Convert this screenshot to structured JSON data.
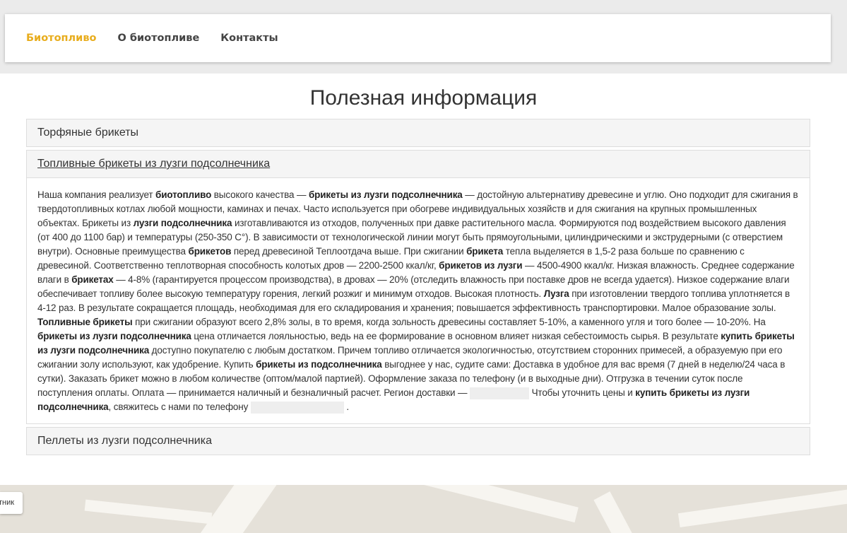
{
  "nav": {
    "items": [
      {
        "label": "Биотопливо",
        "active": true
      },
      {
        "label": "О биотопливе",
        "active": false
      },
      {
        "label": "Контакты",
        "active": false
      }
    ]
  },
  "page": {
    "title": "Полезная информация"
  },
  "accordion": {
    "panel1_title": "Торфяные брикеты",
    "panel2_title": "Топливные брикеты из лузги подсолнечника",
    "panel3_title": "Пеллеты из лузги подсолнечника",
    "body": {
      "t01": "Наша компания реализует ",
      "b01": "биотопливо",
      "t02": " высокого качества — ",
      "b02": "брикеты из лузги подсолнечника",
      "t03": " — достойную альтернативу древесине и углю. Оно подходит для сжигания в твердотопливных котлах любой мощности, каминах и печах. Часто используется при обогреве индивидуальных хозяйств и для сжигания на крупных промышленных объектах. Брикеты из ",
      "b03": "лузги подсолнечника",
      "t04": " изготавливаются из отходов, полученных при давке растительного масла. Формируются под воздействием высокого давления (от 400 до 1100 бар) и температуры (250-350 С°). В зависимости от технологической линии могут быть прямоугольными, цилиндрическими и экструдерными (с отверстием внутри). Основные преимущества ",
      "b04": "брикетов",
      "t05": " перед древесиной Теплоотдача выше. При сжигании ",
      "b05": "брикета",
      "t06": " тепла выделяется в 1,5-2 раза больше по сравнению с древесиной. Соответственно теплотворная способность колотых дров — 2200-2500 ккал/кг, ",
      "b06": "брикетов из лузги",
      "t07": " — 4500-4900 ккал/кг. Низкая влажность. Среднее содержание влаги в ",
      "b07": "брикетах",
      "t08": " — 4-8% (гарантируется процессом производства), в дровах — 20% (отследить влажность при поставке дров не всегда удается). Низкое содержание влаги обеспечивает топливу более высокую температуру горения, легкий розжиг и минимум отходов. Высокая плотность. ",
      "b08": "Лузга",
      "t09": " при изготовлении твердого топлива уплотняется в 4-12 раз. В результате сокращается площадь, необходимая для его складирования и хранения; повышается эффективность транспортировки. Малое образование золы. ",
      "b09": "Топливные брикеты",
      "t10": " при сжигании образуют всего 2,8% золы, в то время, когда зольность древесины составляет 5-10%, а каменного угля и того более — 10-20%. На ",
      "b10": "брикеты из лузги подсолнечника",
      "t11": " цена отличается лояльностью, ведь на ее формирование в основном влияет низкая себестоимость сырья. В результате ",
      "b11": "купить брикеты из лузги подсолнечника",
      "t12": " доступно покупателю с любым достатком. Причем топливо отличается экологичностью, отсутствием сторонних примесей, а образуемую при его сжигании золу используют, как удобрение. Купить ",
      "b12": "брикеты из подсолнечника",
      "t13": " выгоднее у нас, судите сами: Доставка в удобное для вас время (7 дней в неделю/24 часа в сутки). Заказать брикет можно в любом количестве (оптом/малой партией). Оформление заказа по телефону (и в выходные дни). Отгрузка в течении суток после поступления оплаты. Оплата — принимается наличный и безналичный расчет. Регион доставки — ",
      "t14": " Чтобы уточнить цены и ",
      "b13": "купить брикеты из лузги подсолнечника",
      "t15": ", свяжитесь с нами по телефону ",
      "t16": "."
    }
  },
  "map": {
    "button_label": "тник"
  }
}
